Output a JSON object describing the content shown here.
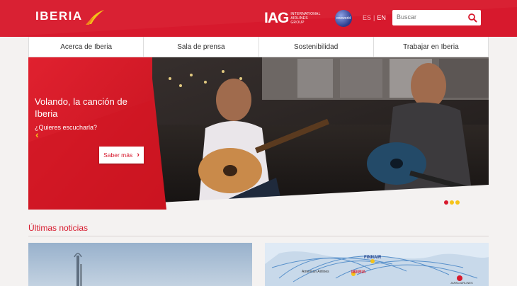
{
  "header": {
    "logo_text": "IBERIA",
    "iag_mark": "IAG",
    "iag_sub_1": "INTERNATIONAL",
    "iag_sub_2": "AIRLINES",
    "iag_sub_3": "GROUP",
    "oneworld_text": "oneworld",
    "lang_es": "ES",
    "lang_sep": "|",
    "lang_en": "EN",
    "search_placeholder": "Buscar",
    "brand_color": "#d7192d"
  },
  "nav": {
    "items": [
      {
        "label": "Acerca de Iberia"
      },
      {
        "label": "Sala de prensa"
      },
      {
        "label": "Sostenibilidad"
      },
      {
        "label": "Trabajar en Iberia"
      }
    ]
  },
  "hero": {
    "title": "Volando, la canción de Iberia",
    "subtitle": "¿Quieres escucharla?",
    "button_label": "Saber más",
    "dots": [
      {
        "color": "#d7192d",
        "active": true
      },
      {
        "color": "#f5c318",
        "active": false
      },
      {
        "color": "#f5c318",
        "active": false
      }
    ]
  },
  "news": {
    "title": "Últimas noticias",
    "right_card_labels": [
      "FINNAIR",
      "IBERIA",
      "American Airlines",
      "JAPAN AIRLINES"
    ]
  }
}
